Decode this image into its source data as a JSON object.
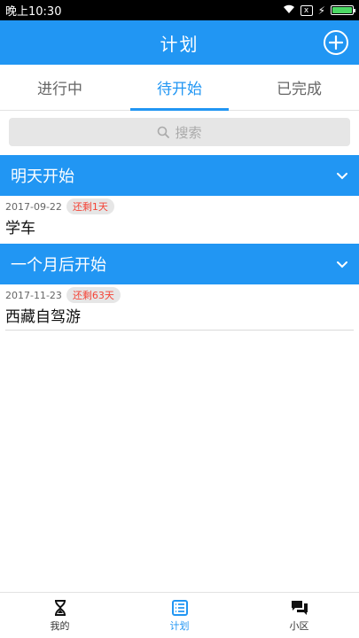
{
  "status_bar": {
    "time": "晚上10:30",
    "x_label": "x"
  },
  "header": {
    "title": "计划",
    "add_icon": "plus-circle-icon"
  },
  "tabs": [
    {
      "label": "进行中",
      "active": false
    },
    {
      "label": "待开始",
      "active": true
    },
    {
      "label": "已完成",
      "active": false
    }
  ],
  "search": {
    "placeholder": "搜索",
    "icon": "search-icon"
  },
  "sections": [
    {
      "title": "明天开始",
      "items": [
        {
          "date": "2017-09-22",
          "badge": "还剩1天",
          "name": "学车"
        }
      ]
    },
    {
      "title": "一个月后开始",
      "items": [
        {
          "date": "2017-11-23",
          "badge": "还剩63天",
          "name": "西藏自驾游"
        }
      ]
    }
  ],
  "bottom_nav": [
    {
      "label": "我的",
      "icon": "hourglass-icon",
      "active": false
    },
    {
      "label": "计划",
      "icon": "list-icon",
      "active": true
    },
    {
      "label": "小区",
      "icon": "chat-icon",
      "active": false
    }
  ],
  "colors": {
    "primary": "#2196f3",
    "badge_text": "#f44336",
    "badge_bg": "#e6e6e6"
  }
}
